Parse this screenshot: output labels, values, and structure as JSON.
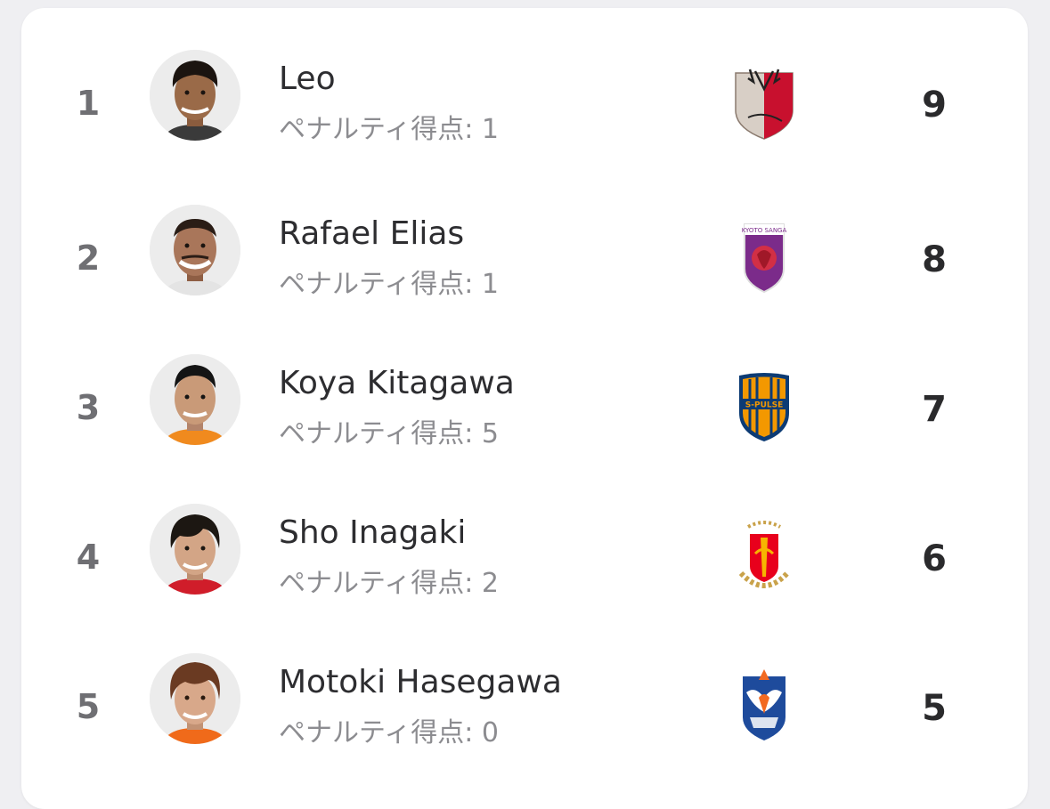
{
  "scorers": [
    {
      "rank": "1",
      "name": "Leo",
      "penalty_label": "ペナルティ得点: 1",
      "goals": "9",
      "club_icon": "kashima-antlers-crest-icon",
      "colors": {
        "skin": "#9a6a48",
        "hair": "#1b1410",
        "shirt": "#3a3a3a",
        "crest_primary": "#c8102e",
        "crest_secondary": "#d8cfc6"
      }
    },
    {
      "rank": "2",
      "name": "Rafael Elias",
      "penalty_label": "ペナルティ得点: 1",
      "goals": "8",
      "club_icon": "kyoto-sanga-crest-icon",
      "colors": {
        "skin": "#a9765a",
        "hair": "#2a1d16",
        "shirt": "#e4e4e4",
        "crest_primary": "#7b2b8a",
        "crest_secondary": "#d22f45"
      }
    },
    {
      "rank": "3",
      "name": "Koya Kitagawa",
      "penalty_label": "ペナルティ得点: 5",
      "goals": "7",
      "club_icon": "shimizu-s-pulse-crest-icon",
      "colors": {
        "skin": "#c99a78",
        "hair": "#141414",
        "shirt": "#f08a1e",
        "crest_primary": "#f39800",
        "crest_secondary": "#0c3b74"
      }
    },
    {
      "rank": "4",
      "name": "Sho Inagaki",
      "penalty_label": "ペナルティ得点: 2",
      "goals": "6",
      "club_icon": "nagoya-grampus-crest-icon",
      "colors": {
        "skin": "#d3a586",
        "hair": "#1c1712",
        "shirt": "#d01d2a",
        "crest_primary": "#e8001c",
        "crest_secondary": "#f7b500"
      }
    },
    {
      "rank": "5",
      "name": "Motoki Hasegawa",
      "penalty_label": "ペナルティ得点: 0",
      "goals": "5",
      "club_icon": "albirex-niigata-crest-icon",
      "colors": {
        "skin": "#d8a88a",
        "hair": "#6a3a22",
        "shirt": "#f06a1a",
        "crest_primary": "#1e4b9c",
        "crest_secondary": "#f26a21"
      }
    }
  ]
}
